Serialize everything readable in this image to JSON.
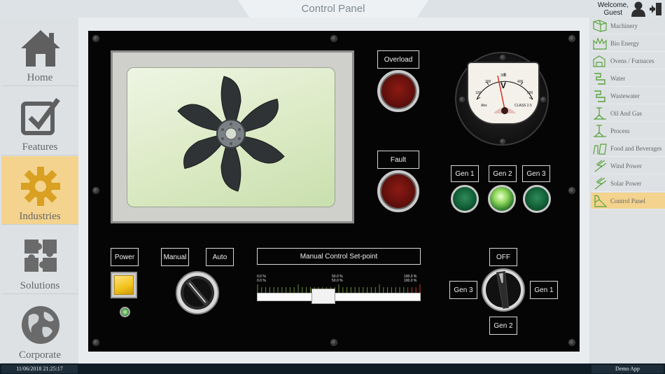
{
  "header": {
    "title": "Control Panel",
    "welcome": "Welcome,",
    "user": "Guest"
  },
  "leftnav": [
    {
      "label": "Home",
      "icon": "home-icon"
    },
    {
      "label": "Features",
      "icon": "checkbox-icon"
    },
    {
      "label": "Industries",
      "icon": "gear-icon",
      "active": true
    },
    {
      "label": "Solutions",
      "icon": "puzzle-icon"
    },
    {
      "label": "Corporate",
      "icon": "globe-icon"
    }
  ],
  "rightnav": [
    {
      "label": "Machinery",
      "icon": "machinery-icon"
    },
    {
      "label": "Bio Energy",
      "icon": "bio-energy-icon"
    },
    {
      "label": "Ovens / Furnaces",
      "icon": "oven-icon"
    },
    {
      "label": "Water",
      "icon": "water-icon"
    },
    {
      "label": "Wastewater",
      "icon": "wastewater-icon"
    },
    {
      "label": "Oil And Gas",
      "icon": "oil-gas-icon"
    },
    {
      "label": "Process",
      "icon": "process-icon"
    },
    {
      "label": "Food and Beverages",
      "icon": "food-beverages-icon"
    },
    {
      "label": "Wind Power",
      "icon": "wind-power-icon"
    },
    {
      "label": "Solar Power",
      "icon": "solar-power-icon"
    },
    {
      "label": "Control Panel",
      "icon": "control-panel-icon",
      "active": true
    }
  ],
  "panel": {
    "overload_label": "Overload",
    "fault_label": "Fault",
    "gen_labels": [
      "Gen 1",
      "Gen 2",
      "Gen 3"
    ],
    "gen_lit_index": 1,
    "power_label": "Power",
    "manual_label": "Manual",
    "auto_label": "Auto",
    "setpoint_label": "Manual Control Set-point",
    "setpoint_value": 0.5,
    "slider_ticks": {
      "min": [
        "0.0 %",
        "0.0 %"
      ],
      "mid": [
        "50.0 %",
        "50.0 %"
      ],
      "max": [
        "100.0 %",
        "100.0 %"
      ]
    },
    "selector": {
      "top": "OFF",
      "left": "Gen 3",
      "right": "Gen 1",
      "bottom": "Gen 2"
    },
    "gauge": {
      "unit": "V",
      "scale": [
        "100",
        "200",
        "300",
        "400",
        "500"
      ],
      "brand": "Abs",
      "class": "CLASS 2.5"
    }
  },
  "status": {
    "datetime": "11/06/2018 21:25:17",
    "app": "Demo App"
  },
  "colors": {
    "accent": "#f3d38d",
    "panel": "#050505",
    "statusbar": "#0e1c26"
  }
}
